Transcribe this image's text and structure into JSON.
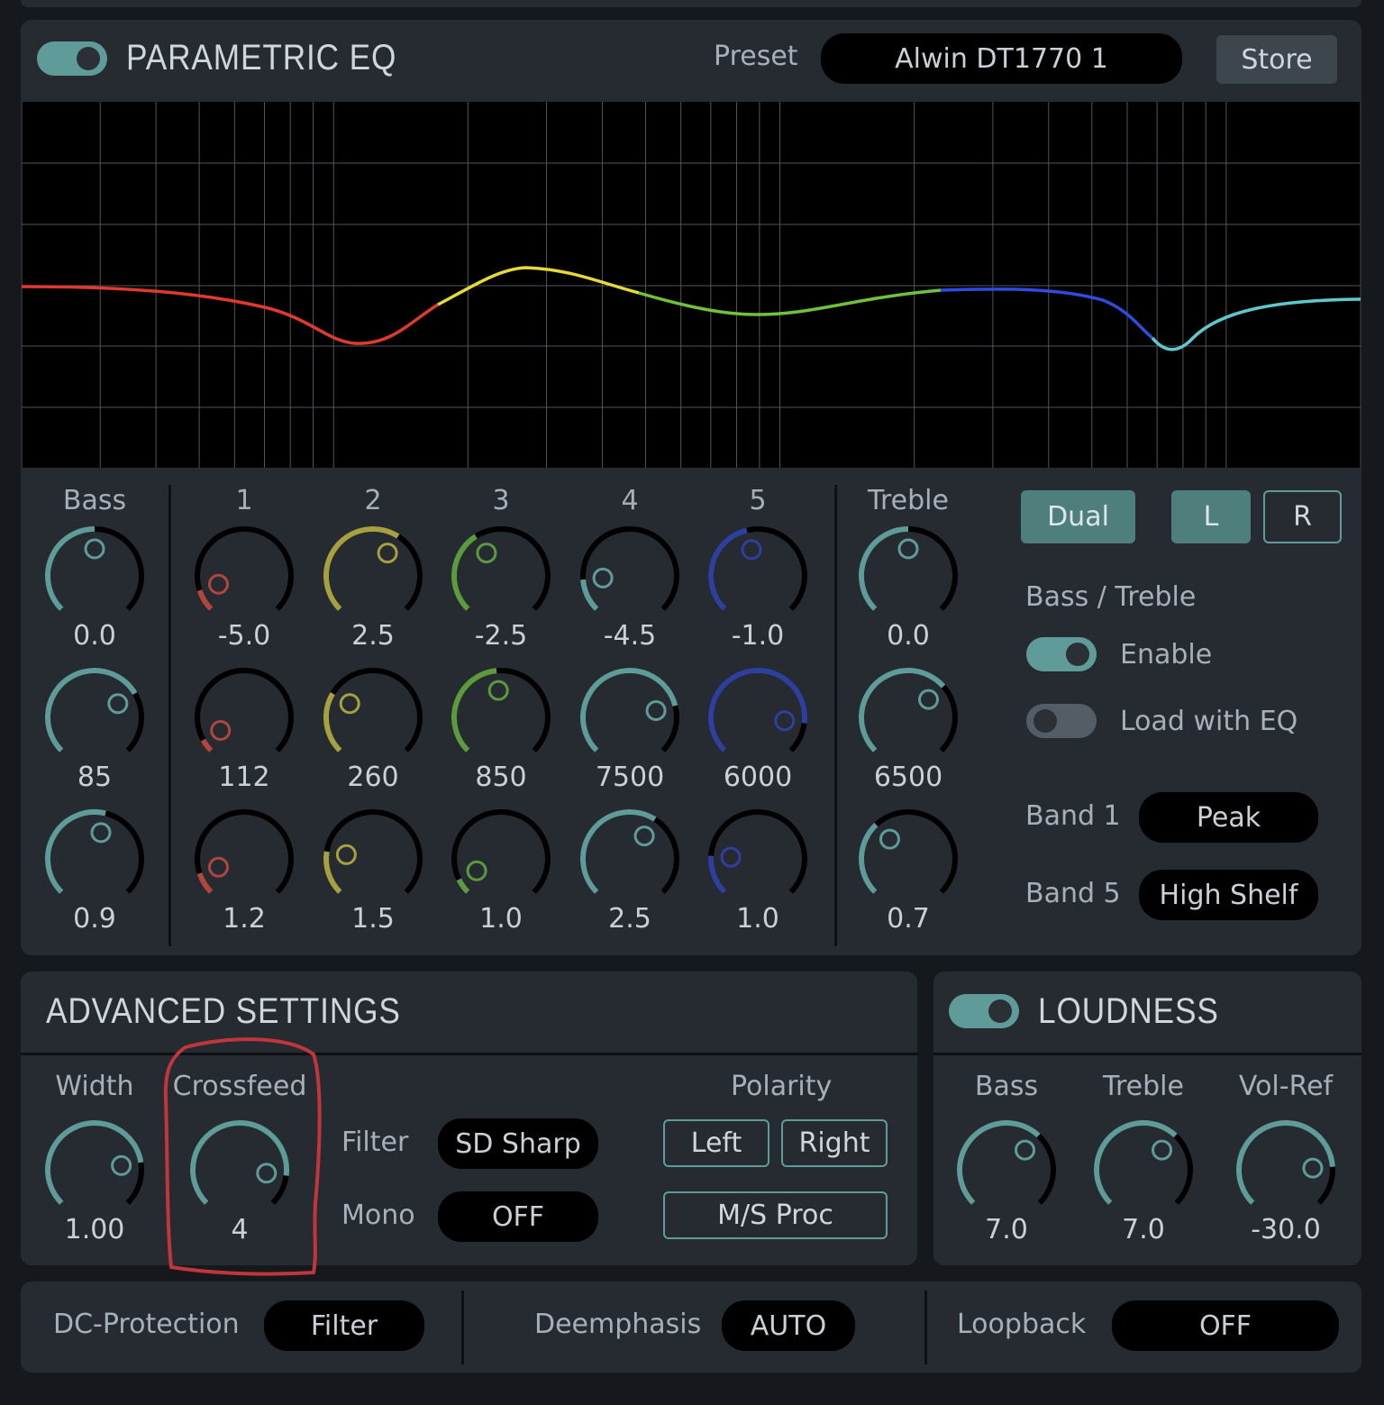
{
  "eq": {
    "title": "PARAMETRIC EQ",
    "enabled": true,
    "preset_label": "Preset",
    "preset_value": "Alwin DT1770 1",
    "store_label": "Store"
  },
  "graph": {
    "curve_colors": [
      "#e03a2f",
      "#e8d93a",
      "#6fc23a",
      "#2f4be0",
      "#5fc8cc"
    ]
  },
  "bands": {
    "bass_label": "Bass",
    "treble_label": "Treble",
    "columns": [
      {
        "label": "Bass",
        "color": "#5f9c99",
        "gain": "0.0",
        "freq": "85",
        "q": "0.9"
      },
      {
        "label": "1",
        "color": "#b0463e",
        "gain": "-5.0",
        "freq": "112",
        "q": "1.2"
      },
      {
        "label": "2",
        "color": "#a6a040",
        "gain": "2.5",
        "freq": "260",
        "q": "1.5"
      },
      {
        "label": "3",
        "color": "#5c9a3e",
        "gain": "-2.5",
        "freq": "850",
        "q": "1.0"
      },
      {
        "label": "4",
        "color": "#5f9c99",
        "gain": "-4.5",
        "freq": "7500",
        "q": "2.5"
      },
      {
        "label": "5",
        "color": "#2f3f9e",
        "gain": "-1.0",
        "freq": "6000",
        "q": "1.0"
      },
      {
        "label": "Treble",
        "color": "#5f9c99",
        "gain": "0.0",
        "freq": "6500",
        "q": "0.7"
      }
    ]
  },
  "channel": {
    "dual": "Dual",
    "left": "L",
    "right": "R"
  },
  "bass_treble": {
    "heading": "Bass / Treble",
    "enable_label": "Enable",
    "enable_on": true,
    "load_label": "Load with EQ",
    "load_on": false,
    "band1_label": "Band 1",
    "band1_value": "Peak",
    "band5_label": "Band 5",
    "band5_value": "High Shelf"
  },
  "advanced": {
    "title": "ADVANCED SETTINGS",
    "width_label": "Width",
    "width_value": "1.00",
    "crossfeed_label": "Crossfeed",
    "crossfeed_value": "4",
    "filter_label": "Filter",
    "filter_value": "SD Sharp",
    "mono_label": "Mono",
    "mono_value": "OFF",
    "polarity_label": "Polarity",
    "polarity_left": "Left",
    "polarity_right": "Right",
    "ms_proc": "M/S Proc"
  },
  "loudness": {
    "title": "LOUDNESS",
    "enabled": true,
    "bass_label": "Bass",
    "bass_value": "7.0",
    "treble_label": "Treble",
    "treble_value": "7.0",
    "volref_label": "Vol-Ref",
    "volref_value": "-30.0"
  },
  "footer": {
    "dc_label": "DC-Protection",
    "dc_value": "Filter",
    "deemph_label": "Deemphasis",
    "deemph_value": "AUTO",
    "loopback_label": "Loopback",
    "loopback_value": "OFF"
  }
}
